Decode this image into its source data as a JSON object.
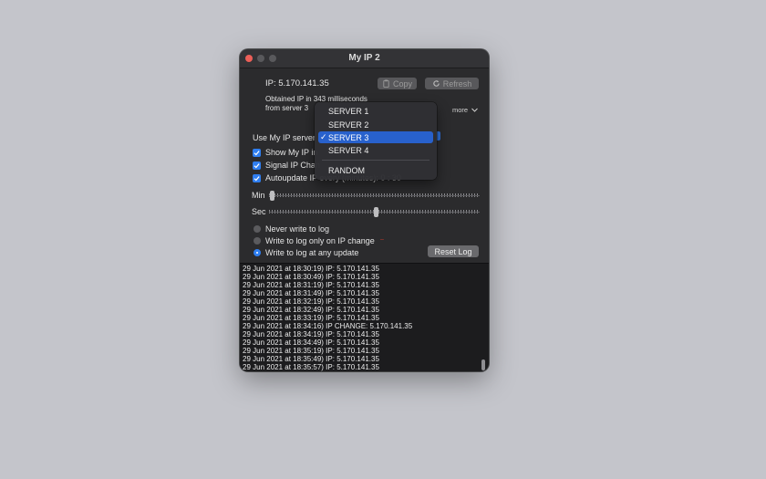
{
  "window": {
    "title": "My IP 2"
  },
  "ip": {
    "text": "IP: 5.170.141.35"
  },
  "buttons": {
    "copy": "Copy",
    "refresh": "Refresh",
    "reset_log": "Reset Log"
  },
  "info": {
    "line1": "Obtained IP in 343 milliseconds",
    "line2": "from server 3"
  },
  "more": "more",
  "server": {
    "label": "Use My IP server"
  },
  "checkboxes": [
    {
      "label": "Show My IP in",
      "checked": true
    },
    {
      "label": "Signal IP Chan",
      "checked": true
    },
    {
      "label": "Autoupdate IP every (minutes): 0 : 30",
      "checked": true
    }
  ],
  "sliders": {
    "min_label": "Min",
    "sec_label": "Sec",
    "min_value": 0,
    "sec_value": 30
  },
  "radios": [
    {
      "label": "Never write to log",
      "selected": false
    },
    {
      "label": "Write to log only on IP change",
      "selected": false
    },
    {
      "label": "Write to log at any update",
      "selected": true
    }
  ],
  "log": [
    "29 Jun 2021 at 18:30:19) IP: 5.170.141.35",
    "29 Jun 2021 at 18:30:49) IP: 5.170.141.35",
    "29 Jun 2021 at 18:31:19) IP: 5.170.141.35",
    "29 Jun 2021 at 18:31:49) IP: 5.170.141.35",
    "29 Jun 2021 at 18:32:19) IP: 5.170.141.35",
    "29 Jun 2021 at 18:32:49) IP: 5.170.141.35",
    "29 Jun 2021 at 18:33:19) IP: 5.170.141.35",
    "29 Jun 2021 at 18:34:16) IP CHANGE: 5.170.141.35",
    "29 Jun 2021 at 18:34:19) IP: 5.170.141.35",
    "29 Jun 2021 at 18:34:49) IP: 5.170.141.35",
    "29 Jun 2021 at 18:35:19) IP: 5.170.141.35",
    "29 Jun 2021 at 18:35:49) IP: 5.170.141.35",
    "29 Jun 2021 at 18:35:57) IP: 5.170.141.35"
  ],
  "dropdown": {
    "items": [
      "SERVER 1",
      "SERVER 2",
      "SERVER 3",
      "SERVER 4",
      "RANDOM"
    ],
    "selected": "SERVER 3"
  },
  "colors": {
    "accent": "#2f7ef0",
    "selection": "#2861cc",
    "close": "#ec5f58"
  }
}
